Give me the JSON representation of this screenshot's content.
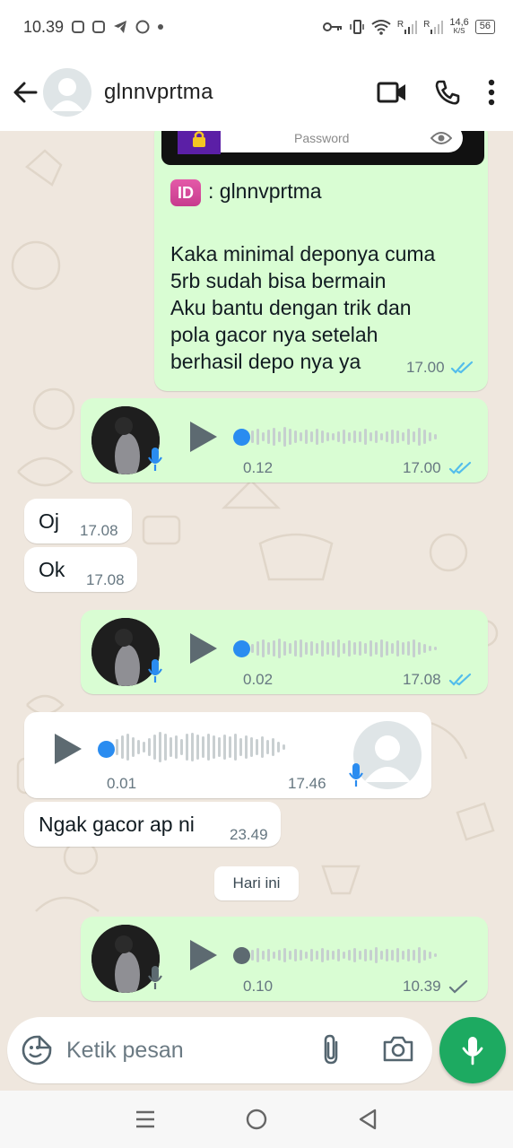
{
  "status_bar": {
    "time": "10.39",
    "net_speed_value": "14,6",
    "net_speed_unit": "K/S",
    "signal_label_1": "R",
    "signal_label_2": "R",
    "battery": "56"
  },
  "header": {
    "contact_name": "glnnvprtma"
  },
  "messages": {
    "m1": {
      "password_placeholder": "Password",
      "id_badge": "ID",
      "id_line": ": glnnvprtma",
      "text_lines": [
        "Kaka minimal deponya cuma",
        "5rb sudah bisa bermain",
        "Aku bantu dengan trik dan",
        "pola gacor nya setelah",
        "berhasil depo nya ya"
      ],
      "time": "17.00"
    },
    "v1": {
      "duration": "0.12",
      "time": "17.00",
      "progress": 0
    },
    "m2": {
      "text": "Oj",
      "time": "17.08"
    },
    "m3": {
      "text": "Ok",
      "time": "17.08"
    },
    "v2": {
      "duration": "0.02",
      "time": "17.08",
      "progress": 0
    },
    "v3": {
      "duration": "0.01",
      "time": "17.46",
      "progress": 0
    },
    "m4": {
      "text": "Ngak gacor ap ni",
      "time": "23.49"
    },
    "date_chip": "Hari ini",
    "v4": {
      "duration": "0.10",
      "time": "10.39",
      "progress": 0
    }
  },
  "composer": {
    "placeholder": "Ketik pesan"
  },
  "colors": {
    "outgoing_bubble": "#d9fdd3",
    "incoming_bubble": "#ffffff",
    "read_ticks": "#53bdeb",
    "accent_green": "#1daa61",
    "voice_dot_blue": "#2a8cf0"
  }
}
